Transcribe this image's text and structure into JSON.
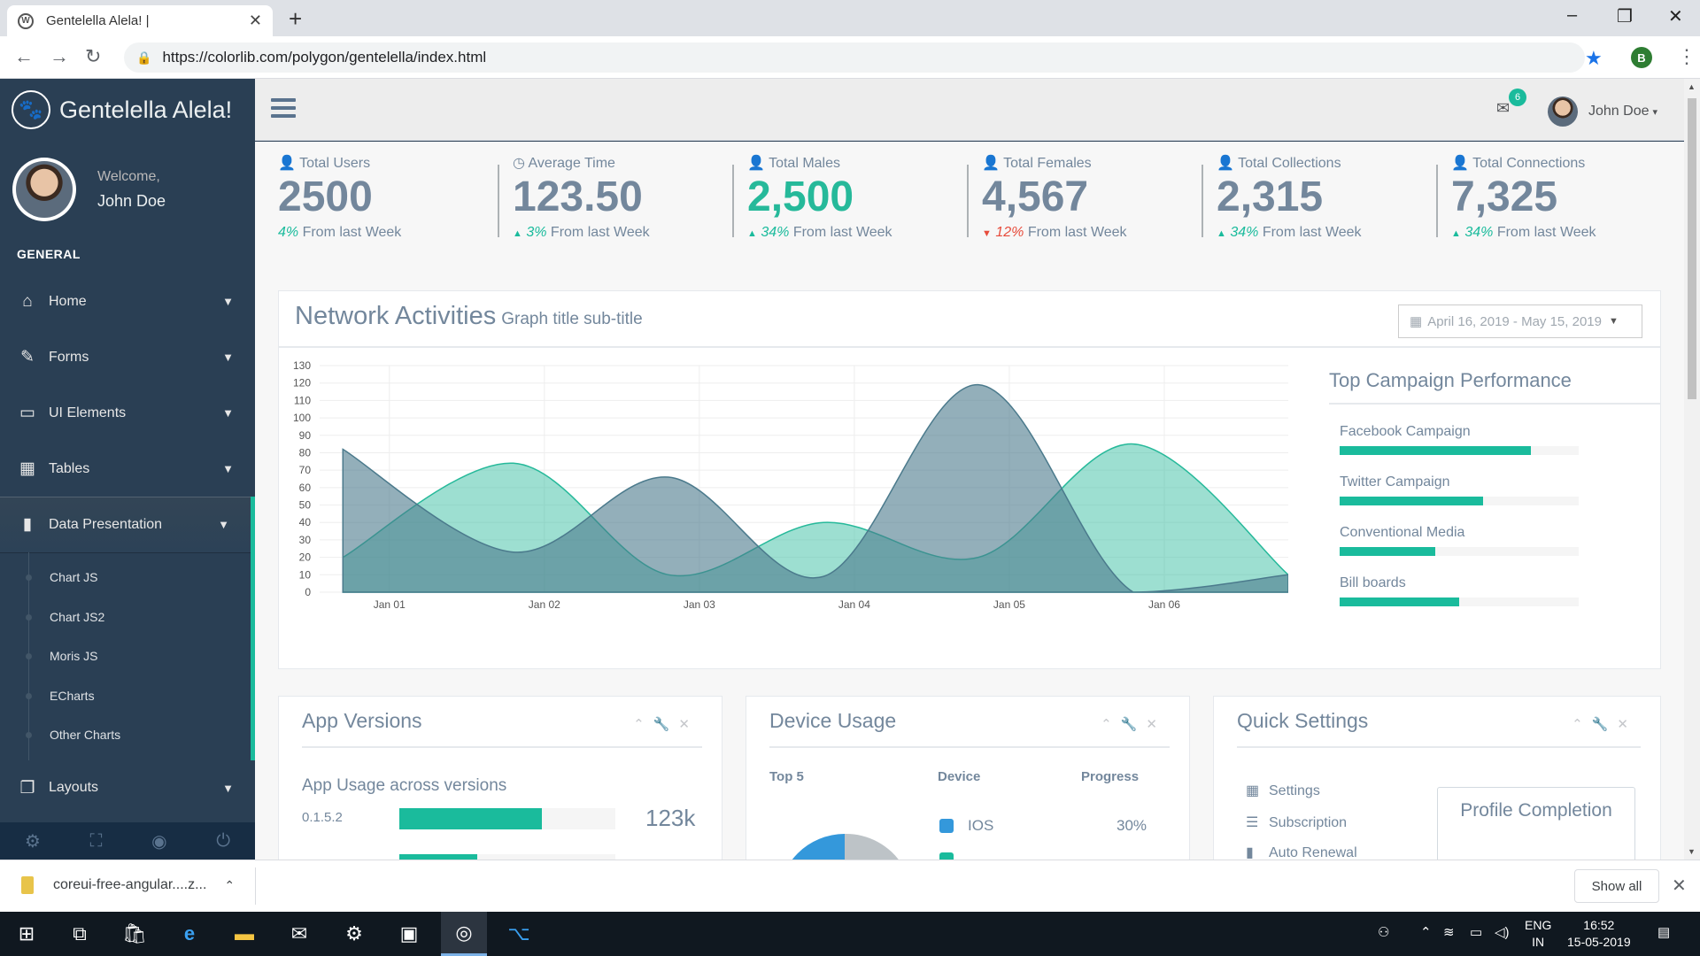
{
  "browser": {
    "tab_title": "Gentelella Alela! |",
    "url": "https://colorlib.com/polygon/gentelella/index.html",
    "profile_initial": "B"
  },
  "sidebar": {
    "brand": "Gentelella Alela!",
    "welcome": "Welcome,",
    "user_name": "John Doe",
    "section_title": "GENERAL",
    "menu": [
      {
        "label": "Home",
        "icon": "home-icon"
      },
      {
        "label": "Forms",
        "icon": "edit-icon"
      },
      {
        "label": "UI Elements",
        "icon": "desktop-icon"
      },
      {
        "label": "Tables",
        "icon": "table-icon"
      },
      {
        "label": "Data Presentation",
        "icon": "bar-chart-icon"
      },
      {
        "label": "Layouts",
        "icon": "clone-icon"
      }
    ],
    "submenu": [
      "Chart JS",
      "Chart JS2",
      "Moris JS",
      "ECharts",
      "Other Charts"
    ]
  },
  "topnav": {
    "mail_count": "6",
    "user_name": "John Doe"
  },
  "tiles": [
    {
      "label": "Total Users",
      "value": "2500",
      "pct": "4%",
      "suffix": "From last Week",
      "trend": "none"
    },
    {
      "label": "Average Time",
      "value": "123.50",
      "pct": "3%",
      "suffix": "From last Week",
      "trend": "up"
    },
    {
      "label": "Total Males",
      "value": "2,500",
      "pct": "34%",
      "suffix": "From last Week",
      "trend": "up"
    },
    {
      "label": "Total Females",
      "value": "4,567",
      "pct": "12%",
      "suffix": "From last Week",
      "trend": "down"
    },
    {
      "label": "Total Collections",
      "value": "2,315",
      "pct": "34%",
      "suffix": "From last Week",
      "trend": "up"
    },
    {
      "label": "Total Connections",
      "value": "7,325",
      "pct": "34%",
      "suffix": "From last Week",
      "trend": "up"
    }
  ],
  "network": {
    "title": "Network Activities",
    "subtitle": "Graph title sub-title",
    "date_range": "April 16, 2019 - May 15, 2019"
  },
  "chart_data": {
    "type": "area",
    "categories": [
      "Jan 01",
      "Jan 02",
      "Jan 03",
      "Jan 04",
      "Jan 05",
      "Jan 06"
    ],
    "ylim": [
      0,
      130
    ],
    "yticks": [
      0,
      10,
      20,
      30,
      40,
      50,
      60,
      70,
      80,
      90,
      100,
      110,
      120,
      130
    ],
    "grid": true,
    "x_points": [
      0.9,
      2.0,
      3.0,
      4.0,
      5.0,
      6.0,
      7.0
    ],
    "series": [
      {
        "color": "#26b99a",
        "opacity": 0.45,
        "values": [
          20,
          74,
          10,
          40,
          20,
          85,
          10
        ]
      },
      {
        "color": "#4b7a8c",
        "opacity": 0.6,
        "values": [
          82,
          23,
          66,
          9,
          119,
          0,
          10
        ]
      }
    ]
  },
  "campaigns": {
    "title": "Top Campaign Performance",
    "items": [
      {
        "label": "Facebook Campaign",
        "value": 0.8
      },
      {
        "label": "Twitter Campaign",
        "value": 0.6
      },
      {
        "label": "Conventional Media",
        "value": 0.4
      },
      {
        "label": "Bill boards",
        "value": 0.5
      }
    ]
  },
  "app_versions": {
    "title": "App Versions",
    "subtitle": "App Usage across versions",
    "rows": [
      {
        "version": "0.1.5.2",
        "value": "123k",
        "fill": 0.66
      }
    ]
  },
  "device_usage": {
    "title": "Device Usage",
    "headers": [
      "Top 5",
      "Device",
      "Progress"
    ],
    "rows": [
      {
        "device": "IOS",
        "progress": "30%",
        "color": "#3498db"
      }
    ]
  },
  "quick_settings": {
    "title": "Quick Settings",
    "items": [
      "Settings",
      "Subscription",
      "Auto Renewal"
    ],
    "profile_completion": "Profile Completion"
  },
  "downloads": {
    "file": "coreui-free-angular....z...",
    "show_all": "Show all"
  },
  "taskbar": {
    "lang": "ENG",
    "region": "IN",
    "time": "16:52",
    "date": "15-05-2019"
  }
}
